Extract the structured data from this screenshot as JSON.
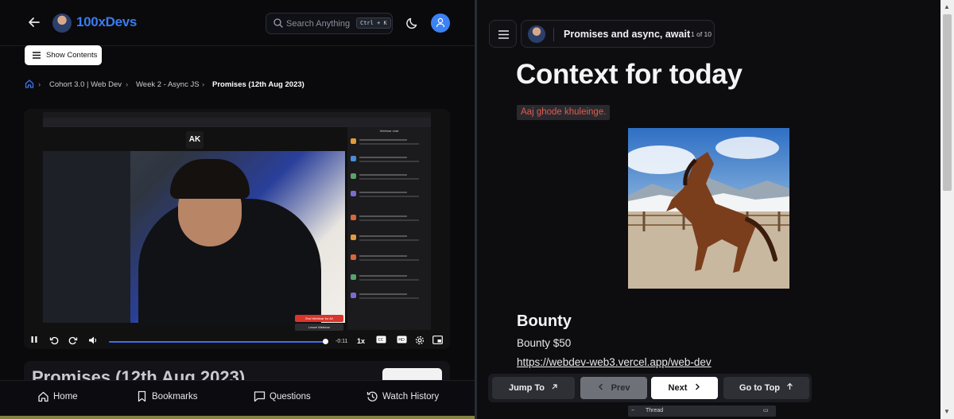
{
  "left": {
    "brand": "100xDevs",
    "search": {
      "placeholder": "Search Anything",
      "shortcut": "Ctrl + K"
    },
    "show_contents_label": "Show Contents",
    "breadcrumbs": [
      "Cohort 3.0 | Web Dev",
      "Week 2 - Async JS",
      "Promises (12th Aug 2023)"
    ],
    "video": {
      "presenter_badge": "AK",
      "webinar_chat_title": "Webinar chat",
      "end_webinar_label": "End Webinar for All",
      "leave_webinar_label": "Leave Webinar",
      "time_remaining": "-0:11",
      "speed": "1x",
      "progress_fraction": 0.98
    },
    "title_card_text": "Promises (12th Aug 2023)",
    "bottom_nav": [
      "Home",
      "Bookmarks",
      "Questions",
      "Watch History"
    ]
  },
  "right": {
    "lesson_title": "Promises and async, await",
    "lesson_count": "1 of 10",
    "heading": "Context for today",
    "callout": "Aaj ghode khuleinge.",
    "bounty_heading": "Bounty",
    "bounty_text": "Bounty $50",
    "bounty_link": "https://webdev-web3.vercel.app/web-dev",
    "pager": {
      "jump_to": "Jump To",
      "prev": "Prev",
      "next": "Next",
      "go_to_top": "Go to Top"
    },
    "thread_label": "Thread"
  },
  "colors": {
    "brand_blue": "#3a7bf0",
    "callout_red": "#e25a4f",
    "end_webinar_red": "#d9352b"
  }
}
